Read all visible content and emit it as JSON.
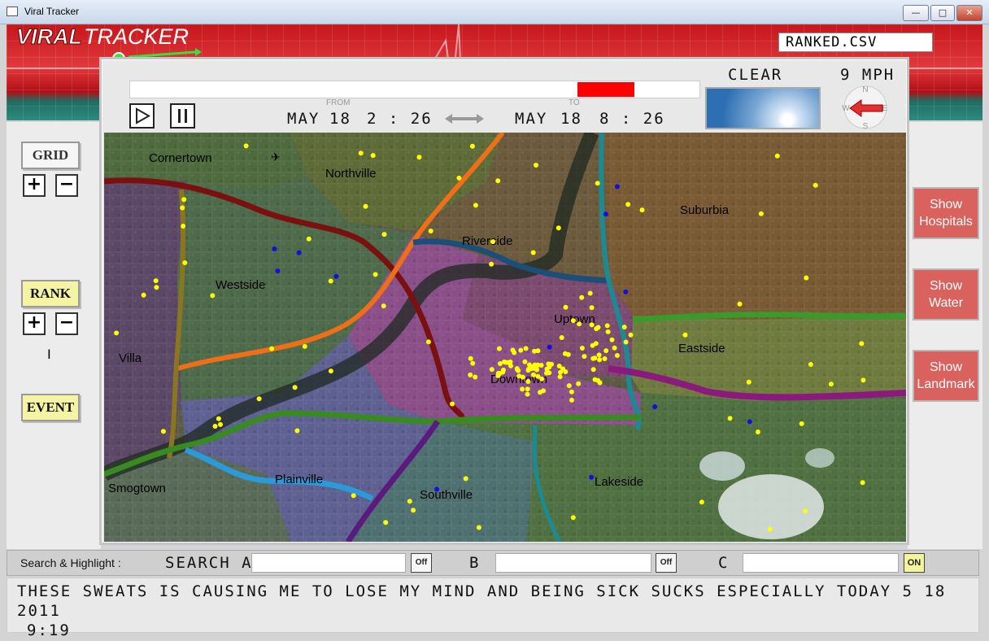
{
  "window": {
    "title": "Viral Tracker",
    "min_glyph": "—",
    "max_glyph": "□",
    "close_glyph": "✕"
  },
  "header": {
    "brand_part1": "VIRAL",
    "brand_part2": "TRACKER",
    "dataset": "RANKED.CSV"
  },
  "playback": {
    "timeline_window_start": 0.786,
    "timeline_window_end": 0.886,
    "from_label": "FROM",
    "to_label": "TO",
    "from_month": "MAY",
    "from_day": "18",
    "from_time": "2 : 26",
    "to_month": "MAY",
    "to_day": "18",
    "to_time": "8 : 26"
  },
  "weather": {
    "condition": "CLEAR",
    "wind": "9 MPH",
    "compass": {
      "n": "N",
      "e": "E",
      "s": "S",
      "w": "W"
    }
  },
  "left_controls": {
    "grid_label": "GRID",
    "rank_label": "RANK",
    "event_label": "EVENT",
    "plus": "+",
    "minus": "−",
    "rank_value": "I"
  },
  "right_controls": {
    "hospitals": [
      "Show",
      "Hospitals"
    ],
    "water": [
      "Show",
      "Water"
    ],
    "landmark": [
      "Show",
      "Landmark"
    ]
  },
  "map": {
    "regions": [
      "Cornertown",
      "Northville",
      "Riverside",
      "Suburbia",
      "Westside",
      "Uptown",
      "Villa",
      "Eastside",
      "Downtown",
      "Smogtown",
      "Plainville",
      "Southville",
      "Lakeside"
    ]
  },
  "search": {
    "label": "Search & Highlight :",
    "a_label": "SEARCH A",
    "b_label": "B",
    "c_label": "C",
    "a_state": "Off",
    "b_state": "Off",
    "c_state": "ON",
    "a_value": "",
    "b_value": "",
    "c_value": ""
  },
  "message": {
    "line1": "THESE SWEATS IS CAUSING ME TO LOSE MY MIND AND BEING SICK SUCKS ESPECIALLY TODAY 5 18 2011",
    "line2": "9:19"
  },
  "colors": {
    "accent_red": "#ff0000",
    "button_red": "#d9625e",
    "highlight_yellow": "#f4f4a4",
    "marker_yellow": "#ffff00",
    "marker_blue": "#1010e0"
  }
}
